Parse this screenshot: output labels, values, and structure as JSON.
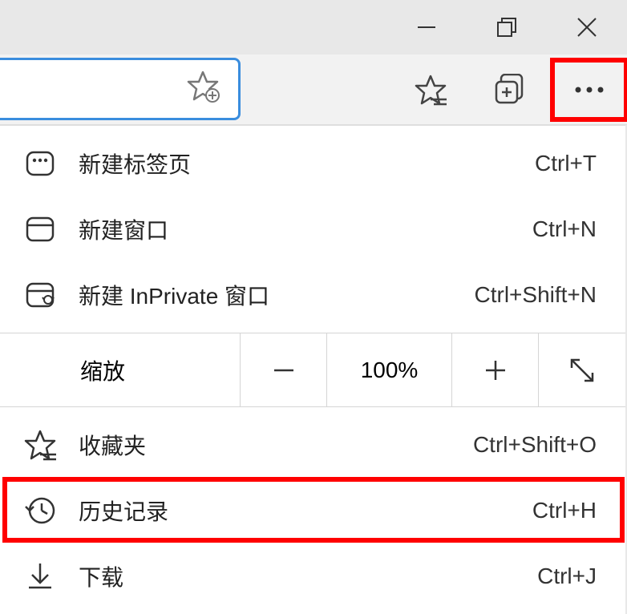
{
  "menu": {
    "new_tab": {
      "label": "新建标签页",
      "shortcut": "Ctrl+T"
    },
    "new_window": {
      "label": "新建窗口",
      "shortcut": "Ctrl+N"
    },
    "new_inprivate": {
      "label": "新建 InPrivate 窗口",
      "shortcut": "Ctrl+Shift+N"
    },
    "zoom": {
      "label": "缩放",
      "value": "100%"
    },
    "favorites": {
      "label": "收藏夹",
      "shortcut": "Ctrl+Shift+O"
    },
    "history": {
      "label": "历史记录",
      "shortcut": "Ctrl+H"
    },
    "downloads": {
      "label": "下载",
      "shortcut": "Ctrl+J"
    }
  }
}
